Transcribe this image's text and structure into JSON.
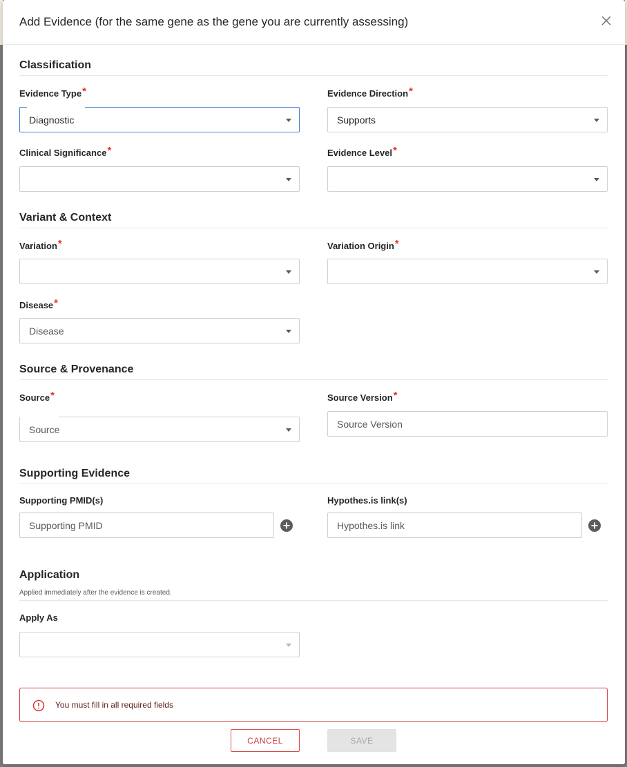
{
  "modal": {
    "title": "Add Evidence (for the same gene as the gene you are currently assessing)"
  },
  "sections": {
    "classification": "Classification",
    "variant_context": "Variant & Context",
    "source_provenance": "Source & Provenance",
    "supporting_evidence": "Supporting Evidence",
    "application": "Application",
    "application_sub": "Applied immediately after the evidence is created."
  },
  "fields": {
    "evidence_type": {
      "label": "Evidence Type",
      "value": "Diagnostic"
    },
    "evidence_direction": {
      "label": "Evidence Direction",
      "value": "Supports"
    },
    "clinical_significance": {
      "label": "Clinical Significance",
      "value": ""
    },
    "evidence_level": {
      "label": "Evidence Level",
      "value": ""
    },
    "variation": {
      "label": "Variation",
      "value": ""
    },
    "variation_origin": {
      "label": "Variation Origin",
      "value": ""
    },
    "disease": {
      "label": "Disease",
      "placeholder": "Disease"
    },
    "source": {
      "label": "Source",
      "placeholder": "Source"
    },
    "source_version": {
      "label": "Source Version",
      "placeholder": "Source Version"
    },
    "supporting_pmids": {
      "label": "Supporting PMID(s)",
      "placeholder": "Supporting PMID"
    },
    "hypothesis_links": {
      "label": "Hypothes.is link(s)",
      "placeholder": "Hypothes.is link"
    },
    "apply_as": {
      "label": "Apply As",
      "value": ""
    }
  },
  "required_marker": "*",
  "alert": {
    "text": "You must fill in all required fields"
  },
  "buttons": {
    "cancel": "CANCEL",
    "save": "SAVE"
  }
}
